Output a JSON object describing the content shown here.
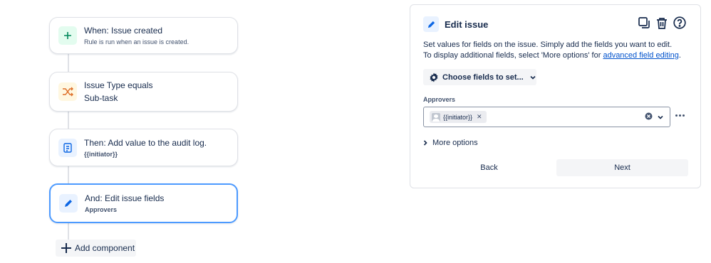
{
  "flow": {
    "nodes": [
      {
        "title": "When: Issue created",
        "sub": "Rule is run when an issue is created.",
        "icon": "plus-icon",
        "icon_bg": "#e3fcef",
        "icon_color": "#00875a"
      },
      {
        "title": "Issue Type equals",
        "sub": "Sub-task",
        "icon": "shuffle-icon",
        "icon_bg": "#fff7e0",
        "icon_color": "#de6e27"
      },
      {
        "title": "Then: Add value to the audit log.",
        "sub": "{{initiator}}",
        "icon": "document-icon",
        "icon_bg": "#e9f2ff",
        "icon_color": "#0c66e4"
      },
      {
        "title": "And: Edit issue fields",
        "sub": "Approvers",
        "icon": "pencil-icon",
        "icon_bg": "#e9f2ff",
        "icon_color": "#0c66e4"
      }
    ],
    "add_component": "Add component"
  },
  "panel": {
    "title": "Edit issue",
    "description_line1": "Set values for fields on the issue. Simply add the fields you want to edit.",
    "description_line2": "To display additional fields, select 'More options' for ",
    "description_link": "advanced field editing",
    "description_end": ".",
    "choose_fields": "Choose fields to set...",
    "field_label": "Approvers",
    "field_value": "{{initiator}}",
    "more_options": "More options",
    "back": "Back",
    "next": "Next"
  },
  "colors": {
    "accent": "#0c66e4",
    "selected_border": "#4c9aff"
  }
}
